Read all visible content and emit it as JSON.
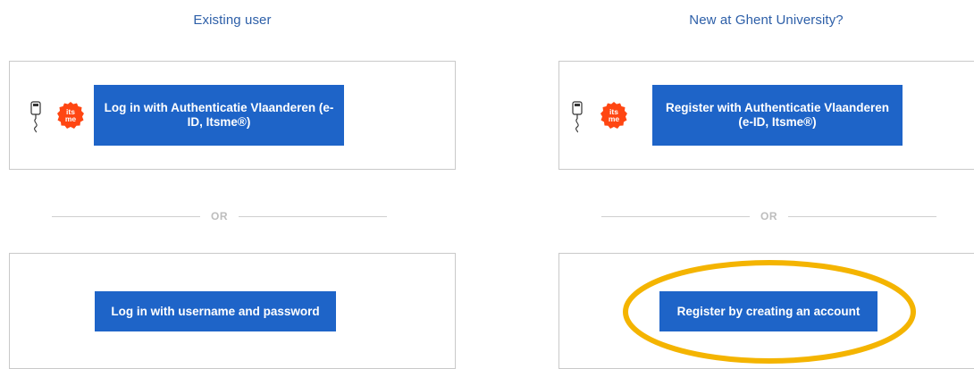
{
  "existing_user": {
    "heading": "Existing user",
    "auth_button_label": "Log in with Authenticatie Vlaanderen (e-ID, Itsme®)",
    "divider_label": "OR",
    "password_button_label": "Log in with username and password"
  },
  "new_user": {
    "heading": "New at Ghent University?",
    "auth_button_label": "Register with Authenticatie Vlaanderen (e-ID, Itsme®)",
    "divider_label": "OR",
    "create_account_button_label": "Register by creating an account"
  },
  "icons": {
    "card_reader": "card-reader-icon",
    "itsme": "itsme-icon",
    "itsme_text": "its me"
  },
  "colors": {
    "primary": "#1e64c8",
    "heading": "#2d5fa8",
    "itsme": "#ff4612",
    "highlight": "#f4b400"
  }
}
